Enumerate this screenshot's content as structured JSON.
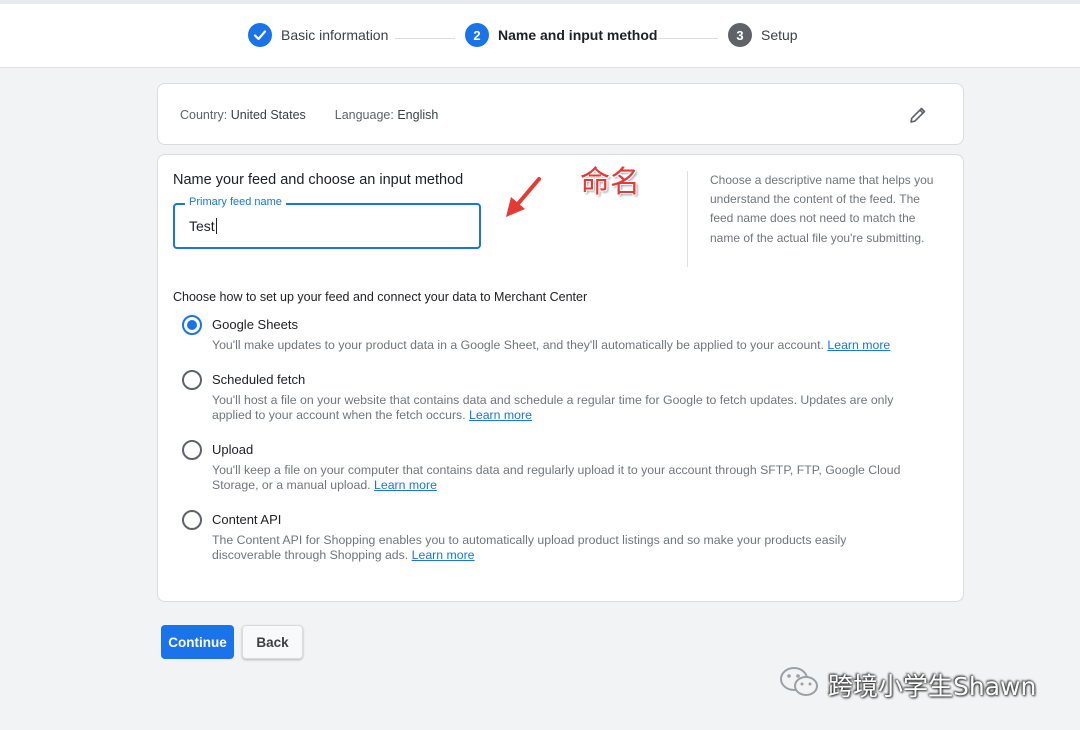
{
  "stepper": {
    "steps": [
      {
        "number": "",
        "label": "Basic information",
        "state": "completed",
        "icon": "check-icon"
      },
      {
        "number": "2",
        "label": "Name and input method",
        "state": "active"
      },
      {
        "number": "3",
        "label": "Setup",
        "state": "upcoming"
      }
    ]
  },
  "locale": {
    "country_label": "Country:",
    "country_value": "United States",
    "language_label": "Language:",
    "language_value": "English",
    "edit_icon": "pencil-icon"
  },
  "feed": {
    "section_title": "Name your feed and choose an input method",
    "name_field_label": "Primary feed name",
    "name_field_value": "Test",
    "annotation": "命名",
    "help_text": "Choose a descriptive name that helps you understand the content of the feed. The feed name does not need to match the name of the actual file you're submitting.",
    "choose_label": "Choose how to set up your feed and connect your data to Merchant Center",
    "learn_more": "Learn more",
    "options": [
      {
        "title": "Google Sheets",
        "description": "You'll make updates to your product data in a Google Sheet, and they'll automatically be applied to your account.",
        "selected": true
      },
      {
        "title": "Scheduled fetch",
        "description": "You'll host a file on your website that contains data and schedule a regular time for Google to fetch updates. Updates are only applied to your account when the fetch occurs.",
        "selected": false
      },
      {
        "title": "Upload",
        "description": "You'll keep a file on your computer that contains data and regularly upload it to your account through SFTP, FTP, Google Cloud Storage, or a manual upload.",
        "selected": false
      },
      {
        "title": "Content API",
        "description": "The Content API for Shopping enables you to automatically upload product listings and so make your products easily discoverable through Shopping ads.",
        "selected": false
      }
    ]
  },
  "actions": {
    "continue_label": "Continue",
    "back_label": "Back"
  },
  "watermark": {
    "text": "跨境小学生Shawn",
    "icon": "wechat-icon"
  },
  "colors": {
    "primary": "#1a73e8",
    "annotation": "#e53935"
  }
}
